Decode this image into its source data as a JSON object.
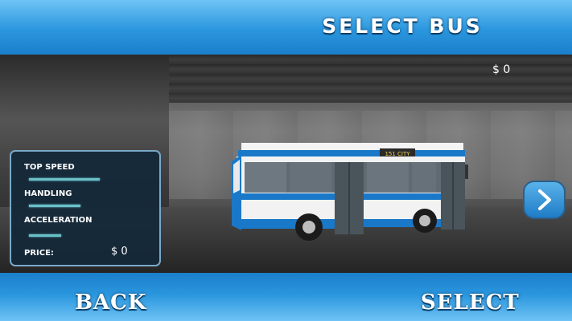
{
  "header": {
    "title": "SELECT BUS"
  },
  "price_display": "$ 0",
  "stats_panel": {
    "stats": [
      {
        "label": "TOP SPEED",
        "level": 0.55
      },
      {
        "label": "HANDLING",
        "level": 0.4
      },
      {
        "label": "ACCELERATION",
        "level": 0.25
      }
    ],
    "price_label": "PRICE:",
    "price_value": "$ 0"
  },
  "bus": {
    "destination_sign": "151  CITY",
    "colors": {
      "body": "#ffffff",
      "stripe": "#1a78c8"
    }
  },
  "navigation": {
    "next_icon": "chevron-right-icon"
  },
  "footer": {
    "back_label": "BACK",
    "select_label": "SELECT"
  },
  "colors": {
    "bar_top": "#2a96de",
    "bar_light": "#6fc3f5",
    "stat_fill": "#6ac1c9",
    "panel_bg": "#14283a"
  }
}
